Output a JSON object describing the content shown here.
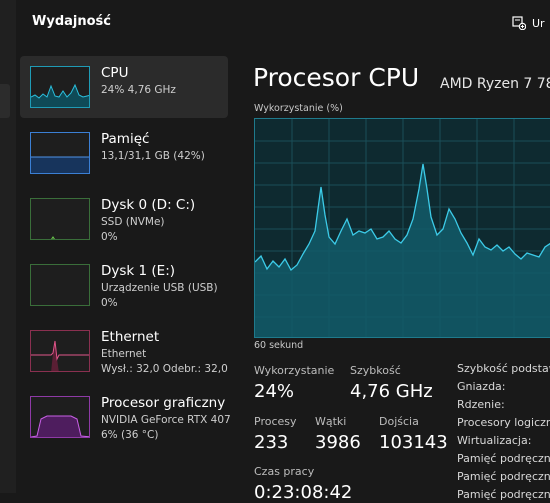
{
  "header": {
    "title": "Wydajność",
    "run_task_label": "Ur"
  },
  "sidebar": {
    "items": [
      {
        "name": "CPU",
        "line1": "24% 4,76 GHz",
        "line2": "",
        "color": "#1f9bb5"
      },
      {
        "name": "Pamięć",
        "line1": "13,1/31,1 GB (42%)",
        "line2": "",
        "color": "#3b7fd4"
      },
      {
        "name": "Dysk 0 (D: C:)",
        "line1": "SSD (NVMe)",
        "line2": "0%",
        "color": "#4caf50"
      },
      {
        "name": "Dysk 1 (E:)",
        "line1": "Urządzenie USB (USB)",
        "line2": "0%",
        "color": "#4caf50"
      },
      {
        "name": "Ethernet",
        "line1": "Ethernet",
        "line2": "Wysł.: 32,0 Odebr.: 32,0",
        "color": "#d3477a"
      },
      {
        "name": "Procesor graficzny",
        "line1": "NVIDIA GeForce RTX 407",
        "line2": "6% (36 °C)",
        "color": "#b147c9"
      }
    ]
  },
  "main": {
    "title": "Procesor CPU",
    "model": "AMD Ryzen 7 78",
    "graph_label": "Wykorzystanie (%)",
    "time_label": "60 sekund",
    "stats": {
      "utilization_label": "Wykorzystanie",
      "utilization_value": "24%",
      "speed_label": "Szybkość",
      "speed_value": "4,76 GHz",
      "processes_label": "Procesy",
      "processes_value": "233",
      "threads_label": "Wątki",
      "threads_value": "3986",
      "handles_label": "Dojścia",
      "handles_value": "103143",
      "uptime_label": "Czas pracy",
      "uptime_value": "0:23:08:42"
    },
    "details": [
      "Szybkość podstaw",
      "Gniazda:",
      "Rdzenie:",
      "Procesory logiczn",
      "Wirtualizacja:",
      "Pamięć podręczna",
      "Pamięć podręczna",
      "Pamięć podręczna"
    ],
    "accent": "#1f9bb5"
  }
}
